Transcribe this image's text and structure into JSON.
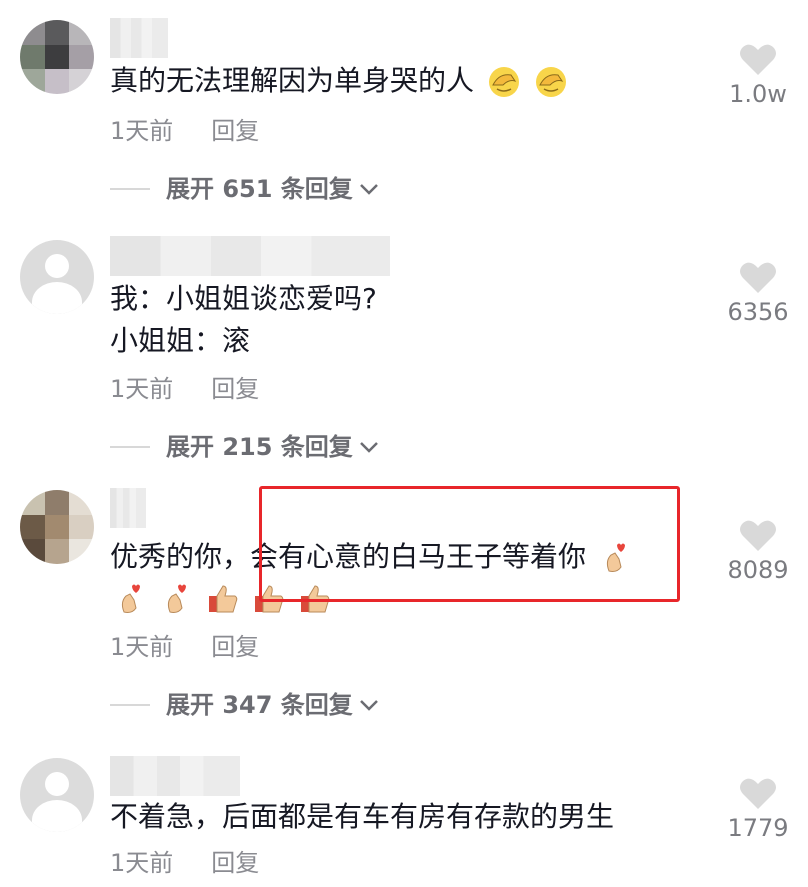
{
  "comments": [
    {
      "text_line1": "真的无法理解因为单身哭的人",
      "time": "1天前",
      "reply": "回复",
      "expand": "展开 651 条回复",
      "likes": "1.0w",
      "emoji": [
        "facepalm-icon",
        "facepalm-icon"
      ]
    },
    {
      "text_line1": "我：小姐姐谈恋爱吗?",
      "text_line2": "小姐姐：滚",
      "time": "1天前",
      "reply": "回复",
      "expand": "展开 215 条回复",
      "likes": "6356"
    },
    {
      "text_line1": "优秀的你，会有心意的白马王子等着你",
      "time": "1天前",
      "reply": "回复",
      "expand": "展开 347 条回复",
      "likes": "8089",
      "emoji": [
        "finger-heart-icon",
        "finger-heart-icon",
        "finger-heart-icon",
        "thumbs-up-icon",
        "thumbs-up-icon",
        "thumbs-up-icon"
      ]
    },
    {
      "text_line1": "不着急，后面都是有车有房有存款的男生",
      "time": "1天前",
      "reply": "回复",
      "likes": "1779"
    }
  ],
  "colors": {
    "highlight_border": "#e8262a",
    "muted_text": "#8a8b91",
    "heart": "#d9d9d9"
  }
}
